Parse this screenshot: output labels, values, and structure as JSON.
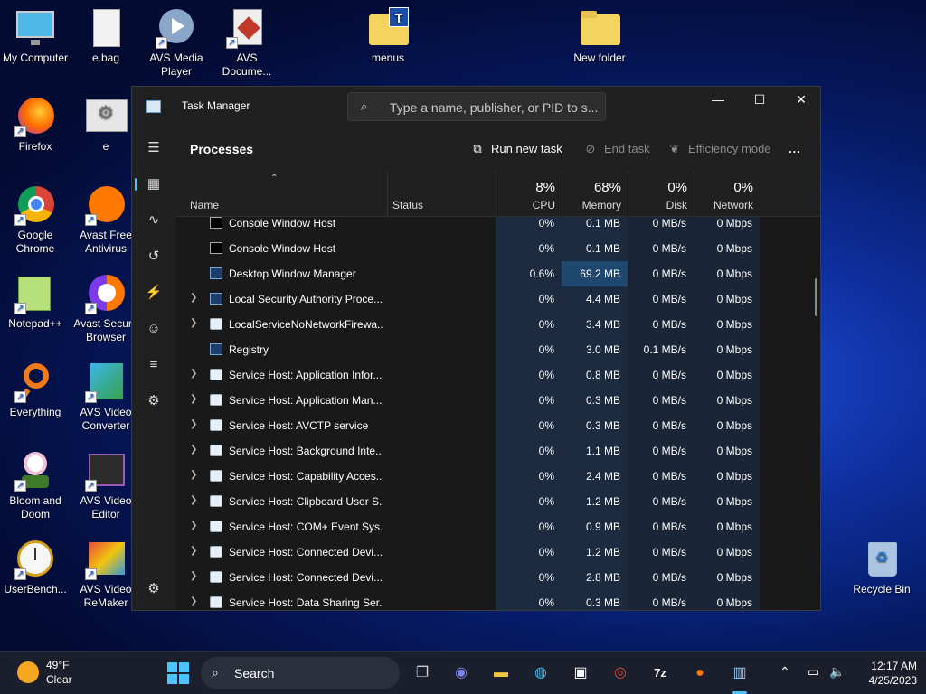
{
  "desktop": {
    "icons": [
      {
        "label": "My Computer",
        "icon": "monitor-icon"
      },
      {
        "label": "e.bag",
        "icon": "document-icon"
      },
      {
        "label": "AVS Media Player",
        "icon": "media-player-icon"
      },
      {
        "label": "AVS Docume...",
        "icon": "avs-document-icon"
      },
      {
        "label": "menus",
        "icon": "folder-icon"
      },
      {
        "label": "New folder",
        "icon": "folder-icon"
      },
      {
        "label": "Firefox",
        "icon": "firefox-icon"
      },
      {
        "label": "e",
        "icon": "settings-file-icon"
      },
      {
        "label": "Google Chrome",
        "icon": "chrome-icon"
      },
      {
        "label": "Avast Free Antivirus",
        "icon": "avast-icon"
      },
      {
        "label": "Notepad++",
        "icon": "notepad-icon"
      },
      {
        "label": "Avast Secure Browser",
        "icon": "avast-browser-icon"
      },
      {
        "label": "Everything",
        "icon": "search-icon"
      },
      {
        "label": "AVS Video Converter",
        "icon": "video-converter-icon"
      },
      {
        "label": "Bloom and Doom",
        "icon": "flower-icon"
      },
      {
        "label": "AVS Video Editor",
        "icon": "video-editor-icon"
      },
      {
        "label": "UserBench...",
        "icon": "stopwatch-icon"
      },
      {
        "label": "AVS Video ReMaker",
        "icon": "video-remaker-icon"
      },
      {
        "label": "Recycle Bin",
        "icon": "recycle-bin-icon"
      }
    ]
  },
  "task_manager": {
    "title": "Task Manager",
    "search_placeholder": "Type a name, publisher, or PID to s...",
    "heading": "Processes",
    "toolbar": {
      "run_new_task": "Run new task",
      "end_task": "End task",
      "efficiency_mode": "Efficiency mode",
      "more": "..."
    },
    "columns": {
      "name": "Name",
      "status": "Status",
      "cpu": {
        "label": "CPU",
        "pct": "8%"
      },
      "memory": {
        "label": "Memory",
        "pct": "68%"
      },
      "disk": {
        "label": "Disk",
        "pct": "0%"
      },
      "network": {
        "label": "Network",
        "pct": "0%"
      }
    },
    "rows": [
      {
        "name": "Console Window Host",
        "expand": false,
        "icon": "console",
        "cpu": "0%",
        "mem": "0.1 MB",
        "disk": "0 MB/s",
        "net": "0 Mbps"
      },
      {
        "name": "Console Window Host",
        "expand": false,
        "icon": "console",
        "cpu": "0%",
        "mem": "0.1 MB",
        "disk": "0 MB/s",
        "net": "0 Mbps"
      },
      {
        "name": "Desktop Window Manager",
        "expand": false,
        "icon": "window",
        "cpu": "0.6%",
        "mem": "69.2 MB",
        "disk": "0 MB/s",
        "net": "0 Mbps"
      },
      {
        "name": "Local Security Authority Proce...",
        "expand": true,
        "icon": "window",
        "cpu": "0%",
        "mem": "4.4 MB",
        "disk": "0 MB/s",
        "net": "0 Mbps"
      },
      {
        "name": "LocalServiceNoNetworkFirewa...",
        "expand": true,
        "icon": "gear",
        "cpu": "0%",
        "mem": "3.4 MB",
        "disk": "0 MB/s",
        "net": "0 Mbps"
      },
      {
        "name": "Registry",
        "expand": false,
        "icon": "window",
        "cpu": "0%",
        "mem": "3.0 MB",
        "disk": "0.1 MB/s",
        "net": "0 Mbps"
      },
      {
        "name": "Service Host: Application Infor...",
        "expand": true,
        "icon": "gear",
        "cpu": "0%",
        "mem": "0.8 MB",
        "disk": "0 MB/s",
        "net": "0 Mbps"
      },
      {
        "name": "Service Host: Application Man...",
        "expand": true,
        "icon": "gear",
        "cpu": "0%",
        "mem": "0.3 MB",
        "disk": "0 MB/s",
        "net": "0 Mbps"
      },
      {
        "name": "Service Host: AVCTP service",
        "expand": true,
        "icon": "gear",
        "cpu": "0%",
        "mem": "0.3 MB",
        "disk": "0 MB/s",
        "net": "0 Mbps"
      },
      {
        "name": "Service Host: Background Inte...",
        "expand": true,
        "icon": "gear",
        "cpu": "0%",
        "mem": "1.1 MB",
        "disk": "0 MB/s",
        "net": "0 Mbps"
      },
      {
        "name": "Service Host: Capability Acces...",
        "expand": true,
        "icon": "gear",
        "cpu": "0%",
        "mem": "2.4 MB",
        "disk": "0 MB/s",
        "net": "0 Mbps"
      },
      {
        "name": "Service Host: Clipboard User S...",
        "expand": true,
        "icon": "gear",
        "cpu": "0%",
        "mem": "1.2 MB",
        "disk": "0 MB/s",
        "net": "0 Mbps"
      },
      {
        "name": "Service Host: COM+ Event Sys...",
        "expand": true,
        "icon": "gear",
        "cpu": "0%",
        "mem": "0.9 MB",
        "disk": "0 MB/s",
        "net": "0 Mbps"
      },
      {
        "name": "Service Host: Connected Devi...",
        "expand": true,
        "icon": "gear",
        "cpu": "0%",
        "mem": "1.2 MB",
        "disk": "0 MB/s",
        "net": "0 Mbps"
      },
      {
        "name": "Service Host: Connected Devi...",
        "expand": true,
        "icon": "gear",
        "cpu": "0%",
        "mem": "2.8 MB",
        "disk": "0 MB/s",
        "net": "0 Mbps"
      },
      {
        "name": "Service Host: Data Sharing Ser...",
        "expand": true,
        "icon": "gear",
        "cpu": "0%",
        "mem": "0.3 MB",
        "disk": "0 MB/s",
        "net": "0 Mbps"
      }
    ]
  },
  "taskbar": {
    "weather": {
      "temp": "49°F",
      "condition": "Clear"
    },
    "search_label": "Search",
    "time": "12:17 AM",
    "date": "4/25/2023"
  }
}
